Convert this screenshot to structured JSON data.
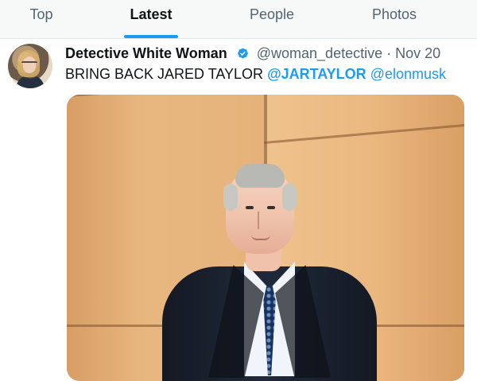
{
  "tabs": [
    {
      "label": "Top",
      "active": false
    },
    {
      "label": "Latest",
      "active": true
    },
    {
      "label": "People",
      "active": false
    },
    {
      "label": "Photos",
      "active": false
    }
  ],
  "tweet": {
    "author_name": "Detective White Woman",
    "handle": "@woman_detective",
    "separator": "·",
    "date": "Nov 20",
    "text_prefix": "BRING BACK JARED TAYLOR",
    "mentions": [
      "@JARTAYLOR",
      "@elonmusk"
    ],
    "verified": true
  },
  "colors": {
    "accent": "#1d9bf0",
    "verified_badge": "#1d9bf0",
    "text_primary": "#0f1419",
    "text_secondary": "#536471"
  },
  "icons": {
    "verified": "verified-badge-icon",
    "avatar": "profile-avatar-image",
    "media": "tweet-photo"
  }
}
